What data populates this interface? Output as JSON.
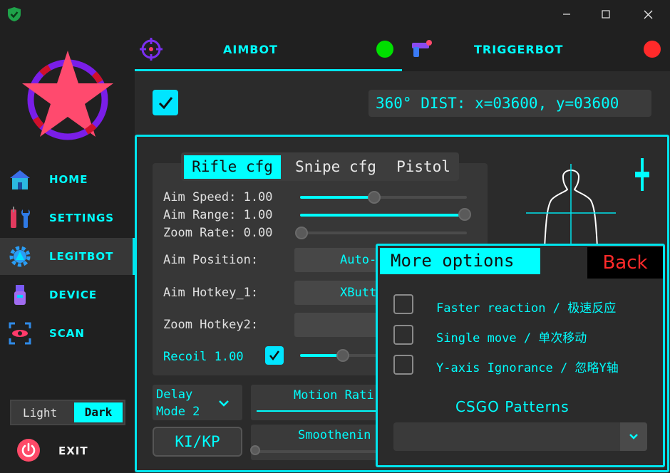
{
  "window": {
    "minimize": "—",
    "maximize": "☐",
    "close": "✕"
  },
  "sidebar": {
    "items": [
      {
        "label": "HOME"
      },
      {
        "label": "SETTINGS"
      },
      {
        "label": "LEGITBOT"
      },
      {
        "label": "DEVICE"
      },
      {
        "label": "SCAN"
      }
    ],
    "theme": {
      "light": "Light",
      "dark": "Dark"
    },
    "exit": "EXIT"
  },
  "tabs": {
    "aimbot": "AIMBOT",
    "triggerbot": "TRIGGERBOT",
    "aimbot_status_color": "#00e000",
    "trigger_status_color": "#ff2a2a"
  },
  "dist": "360° DIST: x=03600, y=03600",
  "cfg_tabs": [
    "Rifle cfg",
    "Snipe cfg",
    "Pistol"
  ],
  "settings": {
    "aim_speed": "Aim Speed: 1.00",
    "aim_range": "Aim Range: 1.00",
    "zoom_rate": "Zoom Rate: 0.00",
    "aim_position": "Aim Position:",
    "aim_position_value": "Auto-",
    "aim_hotkey": "Aim Hotkey_1:",
    "aim_hotkey_value": "XButt",
    "zoom_hotkey": "Zoom Hotkey2:",
    "recoil": "Recoil 1.00",
    "delay_mode": "Delay\nMode 2",
    "delay_mode_l1": "Delay",
    "delay_mode_l2": "Mode 2",
    "motion": "Motion Rati",
    "kikp": "KI/KP",
    "smooth": "Smoothenin"
  },
  "more": {
    "title": "More options",
    "back": "Back",
    "options": [
      "Faster reaction / 极速反应",
      "Single move / 单次移动",
      "Y-axis Ignorance / 忽略Y轴"
    ],
    "patterns": "CSGO Patterns"
  }
}
